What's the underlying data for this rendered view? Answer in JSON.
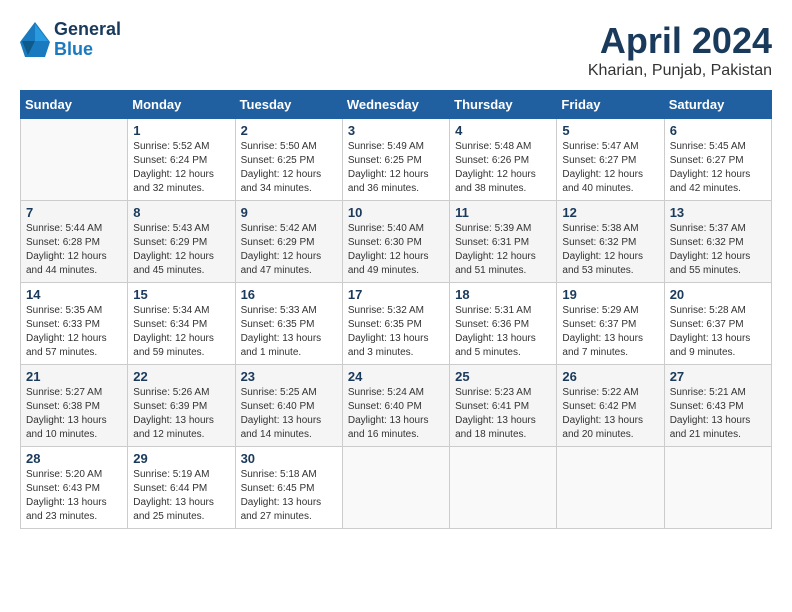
{
  "header": {
    "logo_general": "General",
    "logo_blue": "Blue",
    "title": "April 2024",
    "location": "Kharian, Punjab, Pakistan"
  },
  "calendar": {
    "days_of_week": [
      "Sunday",
      "Monday",
      "Tuesday",
      "Wednesday",
      "Thursday",
      "Friday",
      "Saturday"
    ],
    "weeks": [
      [
        {
          "day": "",
          "info": ""
        },
        {
          "day": "1",
          "info": "Sunrise: 5:52 AM\nSunset: 6:24 PM\nDaylight: 12 hours\nand 32 minutes."
        },
        {
          "day": "2",
          "info": "Sunrise: 5:50 AM\nSunset: 6:25 PM\nDaylight: 12 hours\nand 34 minutes."
        },
        {
          "day": "3",
          "info": "Sunrise: 5:49 AM\nSunset: 6:25 PM\nDaylight: 12 hours\nand 36 minutes."
        },
        {
          "day": "4",
          "info": "Sunrise: 5:48 AM\nSunset: 6:26 PM\nDaylight: 12 hours\nand 38 minutes."
        },
        {
          "day": "5",
          "info": "Sunrise: 5:47 AM\nSunset: 6:27 PM\nDaylight: 12 hours\nand 40 minutes."
        },
        {
          "day": "6",
          "info": "Sunrise: 5:45 AM\nSunset: 6:27 PM\nDaylight: 12 hours\nand 42 minutes."
        }
      ],
      [
        {
          "day": "7",
          "info": "Sunrise: 5:44 AM\nSunset: 6:28 PM\nDaylight: 12 hours\nand 44 minutes."
        },
        {
          "day": "8",
          "info": "Sunrise: 5:43 AM\nSunset: 6:29 PM\nDaylight: 12 hours\nand 45 minutes."
        },
        {
          "day": "9",
          "info": "Sunrise: 5:42 AM\nSunset: 6:29 PM\nDaylight: 12 hours\nand 47 minutes."
        },
        {
          "day": "10",
          "info": "Sunrise: 5:40 AM\nSunset: 6:30 PM\nDaylight: 12 hours\nand 49 minutes."
        },
        {
          "day": "11",
          "info": "Sunrise: 5:39 AM\nSunset: 6:31 PM\nDaylight: 12 hours\nand 51 minutes."
        },
        {
          "day": "12",
          "info": "Sunrise: 5:38 AM\nSunset: 6:32 PM\nDaylight: 12 hours\nand 53 minutes."
        },
        {
          "day": "13",
          "info": "Sunrise: 5:37 AM\nSunset: 6:32 PM\nDaylight: 12 hours\nand 55 minutes."
        }
      ],
      [
        {
          "day": "14",
          "info": "Sunrise: 5:35 AM\nSunset: 6:33 PM\nDaylight: 12 hours\nand 57 minutes."
        },
        {
          "day": "15",
          "info": "Sunrise: 5:34 AM\nSunset: 6:34 PM\nDaylight: 12 hours\nand 59 minutes."
        },
        {
          "day": "16",
          "info": "Sunrise: 5:33 AM\nSunset: 6:35 PM\nDaylight: 13 hours\nand 1 minute."
        },
        {
          "day": "17",
          "info": "Sunrise: 5:32 AM\nSunset: 6:35 PM\nDaylight: 13 hours\nand 3 minutes."
        },
        {
          "day": "18",
          "info": "Sunrise: 5:31 AM\nSunset: 6:36 PM\nDaylight: 13 hours\nand 5 minutes."
        },
        {
          "day": "19",
          "info": "Sunrise: 5:29 AM\nSunset: 6:37 PM\nDaylight: 13 hours\nand 7 minutes."
        },
        {
          "day": "20",
          "info": "Sunrise: 5:28 AM\nSunset: 6:37 PM\nDaylight: 13 hours\nand 9 minutes."
        }
      ],
      [
        {
          "day": "21",
          "info": "Sunrise: 5:27 AM\nSunset: 6:38 PM\nDaylight: 13 hours\nand 10 minutes."
        },
        {
          "day": "22",
          "info": "Sunrise: 5:26 AM\nSunset: 6:39 PM\nDaylight: 13 hours\nand 12 minutes."
        },
        {
          "day": "23",
          "info": "Sunrise: 5:25 AM\nSunset: 6:40 PM\nDaylight: 13 hours\nand 14 minutes."
        },
        {
          "day": "24",
          "info": "Sunrise: 5:24 AM\nSunset: 6:40 PM\nDaylight: 13 hours\nand 16 minutes."
        },
        {
          "day": "25",
          "info": "Sunrise: 5:23 AM\nSunset: 6:41 PM\nDaylight: 13 hours\nand 18 minutes."
        },
        {
          "day": "26",
          "info": "Sunrise: 5:22 AM\nSunset: 6:42 PM\nDaylight: 13 hours\nand 20 minutes."
        },
        {
          "day": "27",
          "info": "Sunrise: 5:21 AM\nSunset: 6:43 PM\nDaylight: 13 hours\nand 21 minutes."
        }
      ],
      [
        {
          "day": "28",
          "info": "Sunrise: 5:20 AM\nSunset: 6:43 PM\nDaylight: 13 hours\nand 23 minutes."
        },
        {
          "day": "29",
          "info": "Sunrise: 5:19 AM\nSunset: 6:44 PM\nDaylight: 13 hours\nand 25 minutes."
        },
        {
          "day": "30",
          "info": "Sunrise: 5:18 AM\nSunset: 6:45 PM\nDaylight: 13 hours\nand 27 minutes."
        },
        {
          "day": "",
          "info": ""
        },
        {
          "day": "",
          "info": ""
        },
        {
          "day": "",
          "info": ""
        },
        {
          "day": "",
          "info": ""
        }
      ]
    ]
  }
}
